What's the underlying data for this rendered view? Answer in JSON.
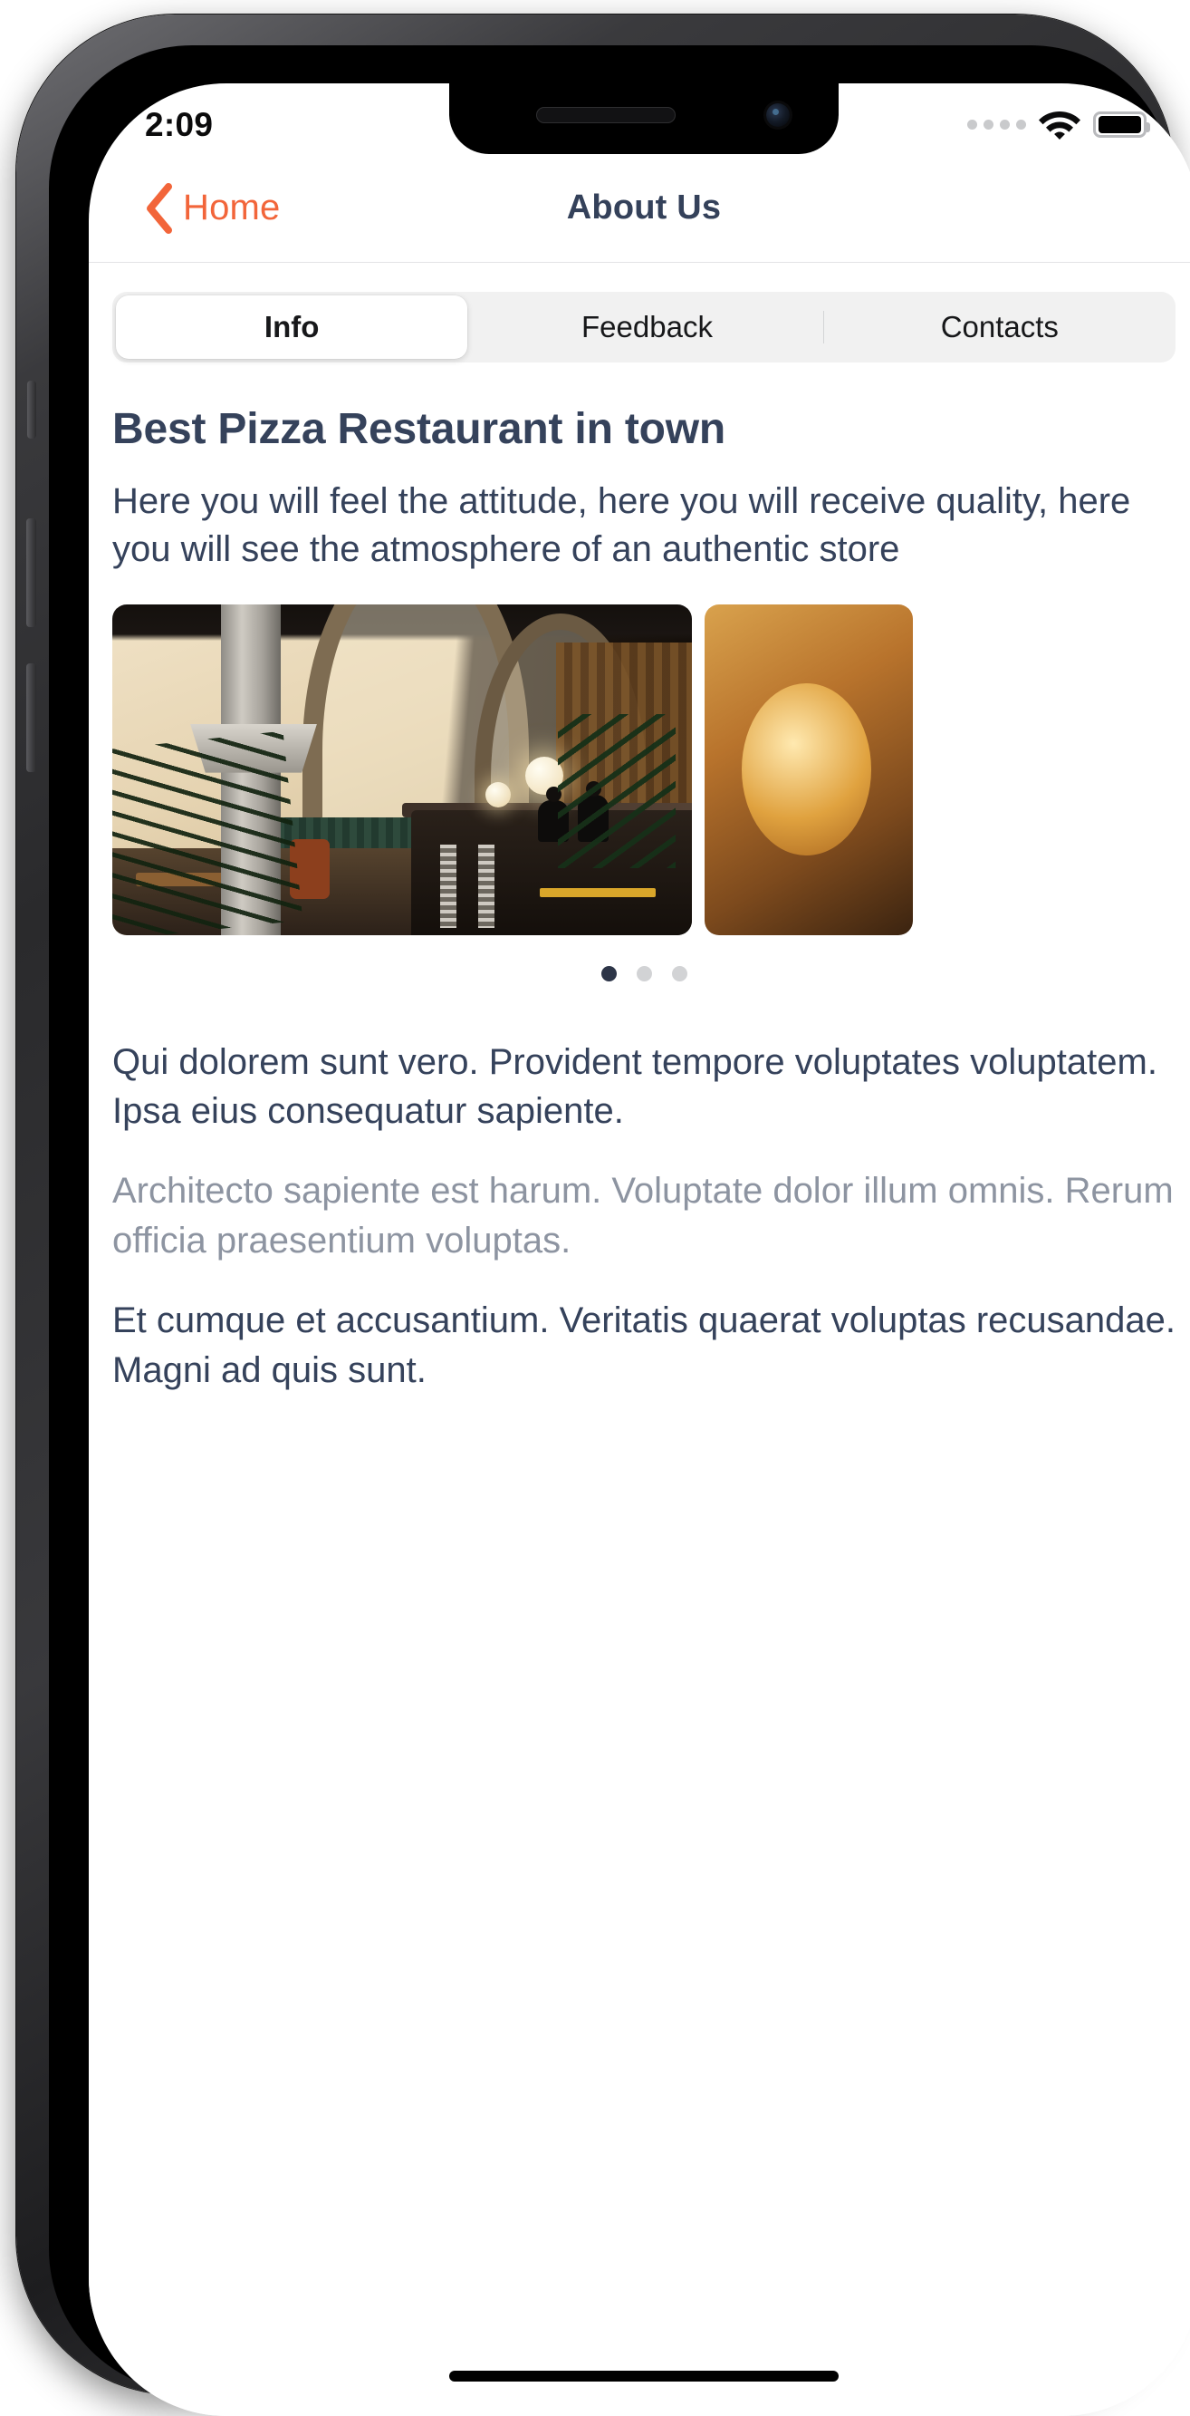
{
  "status_bar": {
    "time": "2:09",
    "signal_icon": "signal-dots-icon",
    "wifi_icon": "wifi-icon",
    "battery_icon": "battery-full-icon"
  },
  "nav_bar": {
    "back_label": "Home",
    "back_icon": "chevron-left-icon",
    "title": "About Us",
    "accent_color": "#f2653a",
    "title_color": "#34415a"
  },
  "segmented_control": {
    "selected_index": 0,
    "segments": [
      {
        "label": "Info"
      },
      {
        "label": "Feedback"
      },
      {
        "label": "Contacts"
      }
    ]
  },
  "info": {
    "title": "Best Pizza Restaurant in town",
    "subtitle": "Here you will feel the attitude, here you will receive quality, here you will see the atmosphere of an authentic store"
  },
  "carousel": {
    "slides": [
      {
        "alt": "Restaurant interior with stone columns, arches and a dark wood bar"
      },
      {
        "alt": "Second restaurant photo partially visible"
      }
    ],
    "dots": [
      {
        "active": true
      },
      {
        "active": false
      },
      {
        "active": false
      }
    ]
  },
  "body": {
    "paragraph_1": "Qui dolorem sunt vero. Provident tempore voluptates voluptatem. Ipsa eius consequatur sapiente.",
    "paragraph_2": "Architecto sapiente est harum. Voluptate dolor illum omnis. Rerum officia praesentium voluptas.",
    "paragraph_3": "Et cumque et accusantium. Veritatis quaerat voluptas recusandae. Magni ad quis sunt."
  },
  "home_indicator": {
    "name": "home-indicator"
  }
}
